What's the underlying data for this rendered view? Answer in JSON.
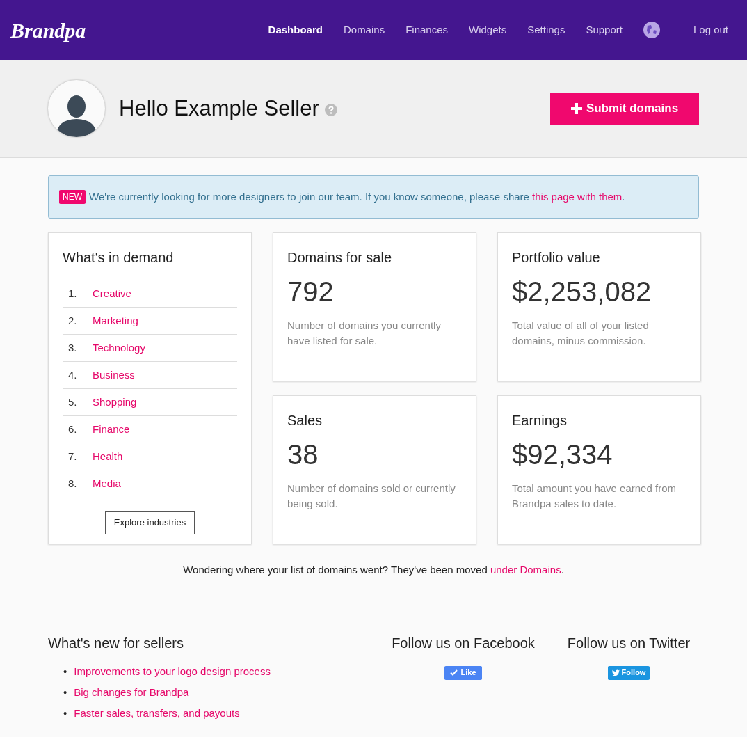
{
  "header": {
    "logo": "Brandpa",
    "nav": [
      {
        "label": "Dashboard",
        "selected": true
      },
      {
        "label": "Domains",
        "selected": false
      },
      {
        "label": "Finances",
        "selected": false
      },
      {
        "label": "Widgets",
        "selected": false
      },
      {
        "label": "Settings",
        "selected": false
      },
      {
        "label": "Support",
        "selected": false
      }
    ],
    "logout": "Log out"
  },
  "hero": {
    "greeting": "Hello Example Seller",
    "submit_button": "Submit domains"
  },
  "notice": {
    "badge": "NEW",
    "text": "We're currently looking for more designers to join our team. If you know someone, please share ",
    "link": "this page with them",
    "end": "."
  },
  "demand": {
    "title": "What's in demand",
    "items": [
      {
        "number": "1.",
        "label": "Creative"
      },
      {
        "number": "2.",
        "label": "Marketing"
      },
      {
        "number": "3.",
        "label": "Technology"
      },
      {
        "number": "4.",
        "label": "Business"
      },
      {
        "number": "5.",
        "label": "Shopping"
      },
      {
        "number": "6.",
        "label": "Finance"
      },
      {
        "number": "7.",
        "label": "Health"
      },
      {
        "number": "8.",
        "label": "Media"
      }
    ],
    "button": "Explore industries"
  },
  "stats": [
    {
      "title": "Domains for sale",
      "value": "792",
      "description": "Number of domains you currently have listed for sale."
    },
    {
      "title": "Portfolio value",
      "value": "$2,253,082",
      "description": "Total value of all of your listed domains, minus commission."
    },
    {
      "title": "Sales",
      "value": "38",
      "description": "Number of domains sold or currently being sold."
    },
    {
      "title": "Earnings",
      "value": "$92,334",
      "description": "Total amount you have earned from Brandpa sales to date."
    }
  ],
  "moved_note": {
    "text": "Wondering where your list of domains went? They've been moved ",
    "link": "under Domains",
    "end": "."
  },
  "news": {
    "title": "What's new for sellers",
    "items": [
      {
        "bullet": "•",
        "label": "Improvements to your logo design process"
      },
      {
        "bullet": "•",
        "label": "Big changes for Brandpa"
      },
      {
        "bullet": "•",
        "label": "Faster sales, transfers, and payouts"
      }
    ]
  },
  "facebook": {
    "title": "Follow us on Facebook",
    "button": "Like"
  },
  "twitter": {
    "title": "Follow us on Twitter",
    "button": "Follow"
  }
}
